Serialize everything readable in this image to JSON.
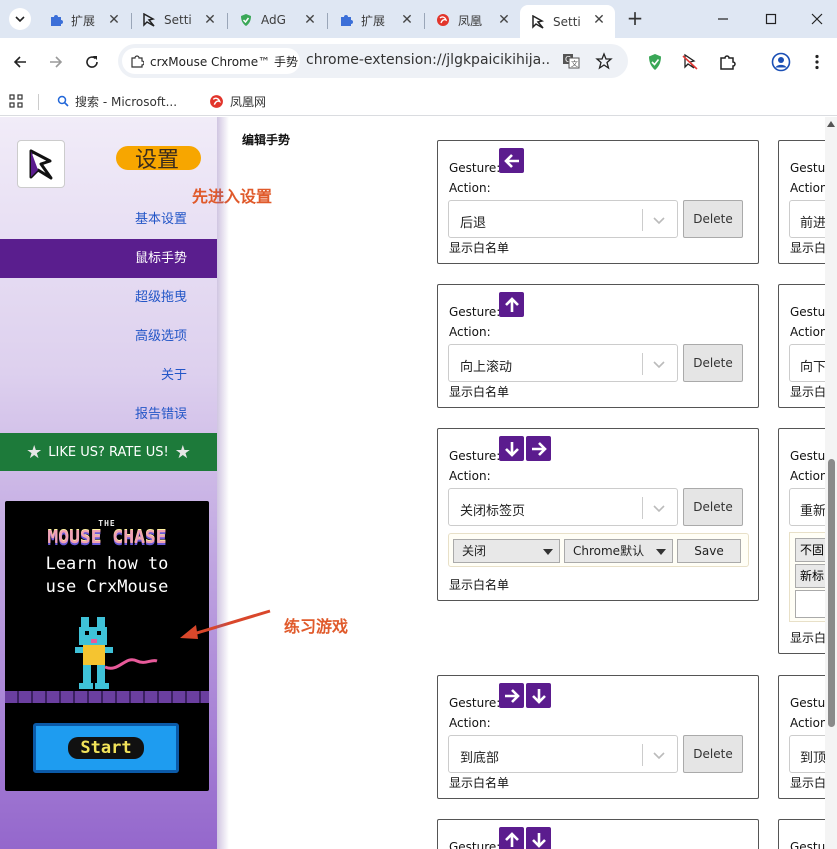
{
  "browser": {
    "tabs": [
      {
        "title": "扩展",
        "icon": "puzzle-icon"
      },
      {
        "title": "Setti",
        "icon": "crxmouse-icon"
      },
      {
        "title": "AdG",
        "icon": "adguard-icon"
      },
      {
        "title": "扩展",
        "icon": "puzzle-icon"
      },
      {
        "title": "凤凰",
        "icon": "phoenix-icon"
      },
      {
        "title": "Setti",
        "icon": "crxmouse-icon",
        "active": true
      }
    ],
    "omnibox": {
      "chip": "crxMouse Chrome™ 手势",
      "url": "chrome-extension://jlgkpaicikihija..."
    },
    "bookmarks": [
      {
        "label": "搜索 - Microsoft...",
        "icon": "bing-search-icon"
      },
      {
        "label": "凤凰网",
        "icon": "phoenix-icon"
      }
    ]
  },
  "sidebar": {
    "title": "设置",
    "annotation_settings": "先进入设置",
    "menu": [
      {
        "label": "基本设置",
        "active": false
      },
      {
        "label": "鼠标手势",
        "active": true
      },
      {
        "label": "超级拖曳",
        "active": false
      },
      {
        "label": "高级选项",
        "active": false
      },
      {
        "label": "关于",
        "active": false
      },
      {
        "label": "报告错误",
        "active": false
      }
    ],
    "rate": "LIKE US? RATE US!",
    "game": {
      "the": "THE",
      "title": "MOUSE CHASE",
      "line1": "Learn how to",
      "line2": "use CrxMouse",
      "start": "Start"
    },
    "annotation_game": "练习游戏"
  },
  "content": {
    "section_title": "编辑手势",
    "gesture_label": "Gesture:",
    "action_label": "Action:",
    "delete_label": "Delete",
    "whitelist_label": "显示白名单",
    "cards": [
      {
        "arrows": [
          "left"
        ],
        "action": "后退"
      },
      {
        "arrows": [
          "up"
        ],
        "action": "向上滚动"
      },
      {
        "arrows": [
          "down",
          "right"
        ],
        "action": "关闭标签页",
        "sub": {
          "opt1": "关闭",
          "opt2": "Chrome默认",
          "save": "Save"
        }
      },
      {
        "arrows": [
          "right",
          "down"
        ],
        "action": "到底部"
      },
      {
        "arrows": [
          "up",
          "down"
        ],
        "action": ""
      }
    ],
    "right_cards": [
      {
        "gesture": "Gestu",
        "action": "Action",
        "value": "前进",
        "wl": "显示白"
      },
      {
        "gesture": "Gestu",
        "action": "Action",
        "value": "向下",
        "wl": "显示白"
      },
      {
        "gesture": "Gestu",
        "action": "Action",
        "value": "重新",
        "sub1": "不固",
        "sub2": "新标",
        "wl": "显示白"
      },
      {
        "gesture": "Gestu",
        "action": "Action",
        "value": "到顶",
        "wl": "显示白"
      },
      {
        "gesture": "Gestu"
      }
    ]
  },
  "colors": {
    "accent_purple": "#5b1c8e",
    "annotation": "#e05a2b",
    "title_pill": "#f7a600",
    "rate_green": "#1d7a3a"
  }
}
